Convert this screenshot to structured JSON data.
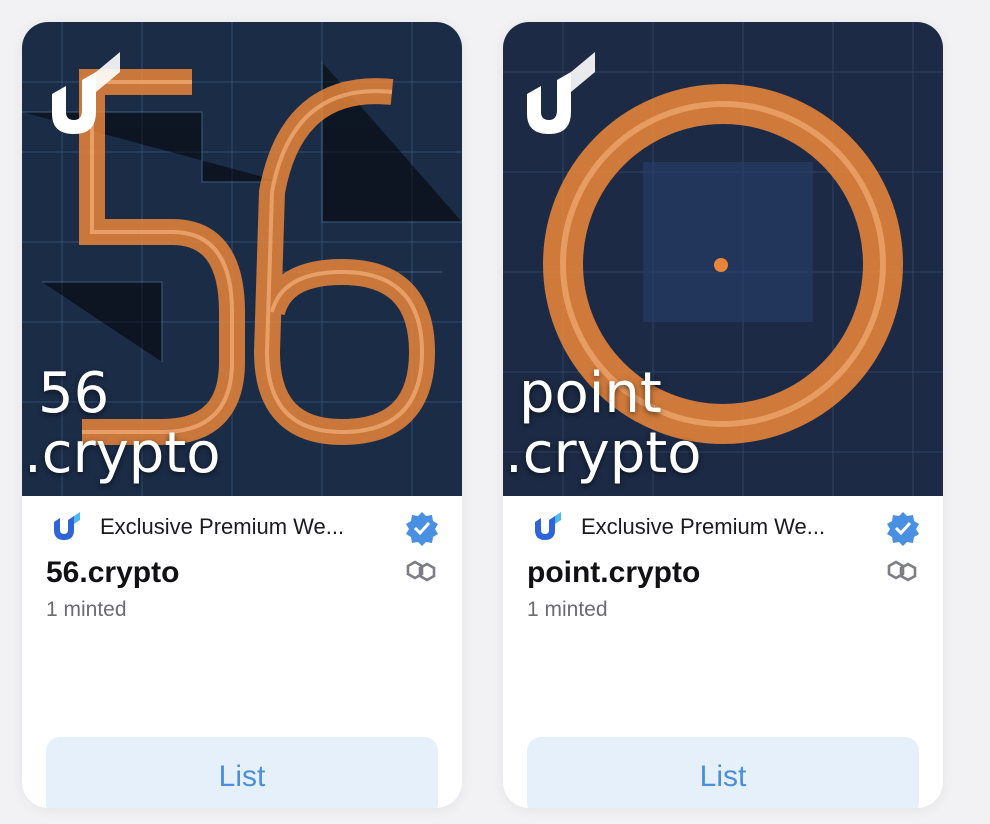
{
  "cards": [
    {
      "art_name": "56",
      "art_tld": ".crypto",
      "collection": "Exclusive Premium We...",
      "title": "56.crypto",
      "minted": "1 minted",
      "button": "List"
    },
    {
      "art_name": "point",
      "art_tld": ".crypto",
      "collection": "Exclusive Premium We...",
      "title": "point.crypto",
      "minted": "1 minted",
      "button": "List"
    }
  ],
  "colors": {
    "accent": "#4a90d9",
    "button_bg": "#e6f0fb",
    "art_bg": "#1a2a44",
    "art_orange": "#e8853a"
  },
  "icons": [
    "unstoppable-logo-icon",
    "verified-badge-icon",
    "chain-link-icon"
  ]
}
